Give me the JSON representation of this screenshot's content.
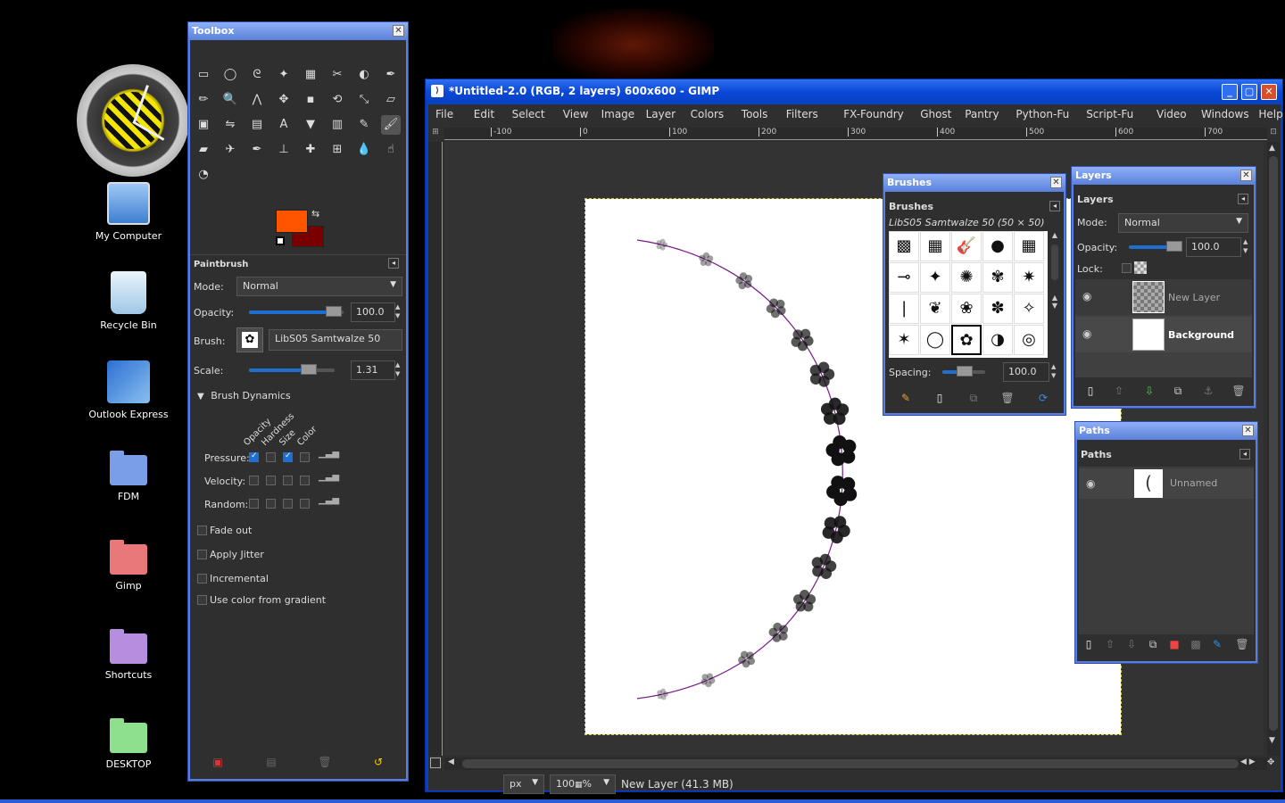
{
  "desktop": {
    "icons": [
      {
        "label": "My Computer"
      },
      {
        "label": "Recycle Bin"
      },
      {
        "label": "Outlook Express"
      },
      {
        "label": "FDM"
      },
      {
        "label": "Gimp"
      },
      {
        "label": "Shortcuts"
      },
      {
        "label": "DESKTOP"
      }
    ]
  },
  "toolbox": {
    "title": "Toolbox",
    "fg_color": "#ff5500",
    "bg_color": "#7a0000",
    "options_title": "Paintbrush",
    "mode_label": "Mode:",
    "mode_value": "Normal",
    "opacity_label": "Opacity:",
    "opacity_value": "100.0",
    "brush_label": "Brush:",
    "brush_value": "LibS05 Samtwalze 50",
    "scale_label": "Scale:",
    "scale_value": "1.31",
    "dynamics_label": "Brush Dynamics",
    "dyn_cols": [
      "Opacity",
      "Hardness",
      "Size",
      "Color"
    ],
    "dyn_rows": [
      "Pressure:",
      "Velocity:",
      "Random:"
    ],
    "options": [
      "Fade out",
      "Apply Jitter",
      "Incremental",
      "Use color from gradient"
    ]
  },
  "image_window": {
    "title": "*Untitled-2.0 (RGB, 2 layers) 600x600 - GIMP",
    "menu": [
      "File",
      "Edit",
      "Select",
      "View",
      "Image",
      "Layer",
      "Colors",
      "Tools",
      "Filters",
      "FX-Foundry",
      "Ghost",
      "Pantry",
      "Python-Fu",
      "Script-Fu",
      "Video",
      "Windows",
      "Help"
    ],
    "ruler_ticks": [
      "-100",
      "0",
      "100",
      "200",
      "300",
      "400",
      "500",
      "600",
      "700"
    ],
    "unit": "px",
    "zoom": "100",
    "zoom_suffix": "%",
    "status": "New Layer (41.3 MB)"
  },
  "brushes": {
    "title": "Brushes",
    "header": "Brushes",
    "selected": "LibS05 Samtwalze 50 (50 × 50)",
    "spacing_label": "Spacing:",
    "spacing_value": "100.0"
  },
  "layers": {
    "title": "Layers",
    "header": "Layers",
    "mode_label": "Mode:",
    "mode_value": "Normal",
    "opacity_label": "Opacity:",
    "opacity_value": "100.0",
    "lock_label": "Lock:",
    "items": [
      {
        "name": "New Layer"
      },
      {
        "name": "Background"
      }
    ]
  },
  "paths": {
    "title": "Paths",
    "header": "Paths",
    "items": [
      {
        "name": "Unnamed"
      }
    ]
  }
}
